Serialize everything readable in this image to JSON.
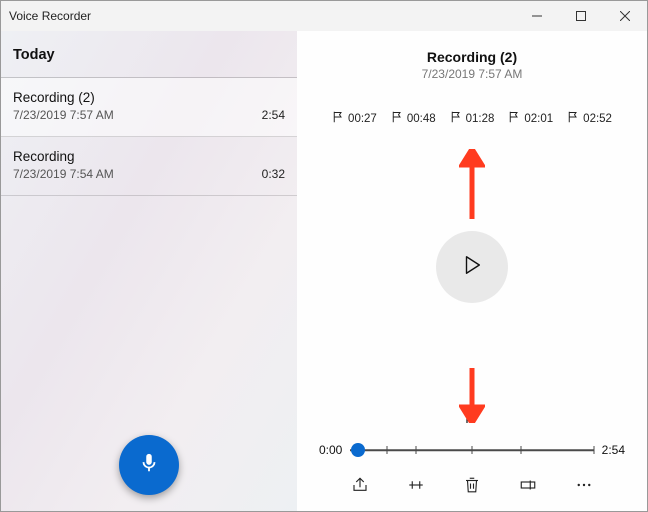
{
  "window": {
    "title": "Voice Recorder"
  },
  "sidebar": {
    "section_label": "Today",
    "recordings": [
      {
        "name": "Recording (2)",
        "date": "7/23/2019 7:57 AM",
        "duration": "2:54"
      },
      {
        "name": "Recording",
        "date": "7/23/2019 7:54 AM",
        "duration": "0:32"
      }
    ]
  },
  "player": {
    "title": "Recording (2)",
    "subtitle": "7/23/2019 7:57 AM",
    "markers": [
      "00:27",
      "00:48",
      "01:28",
      "02:01",
      "02:52"
    ],
    "current_time_label": "0:00",
    "total_time_label": "2:54",
    "progress_pct": 3,
    "tick_pcts": [
      3,
      15,
      27,
      50,
      70,
      100
    ]
  },
  "icons": {
    "recording_icon": "microphone-icon",
    "play_icon": "play-icon",
    "flag_icon": "flag-icon",
    "share_icon": "share-icon",
    "trim_icon": "trim-icon",
    "delete_icon": "trash-icon",
    "rename_icon": "rename-icon",
    "more_icon": "ellipsis-icon"
  },
  "colors": {
    "accent": "#0a6acf",
    "arrow_red": "#ff3b1f"
  }
}
